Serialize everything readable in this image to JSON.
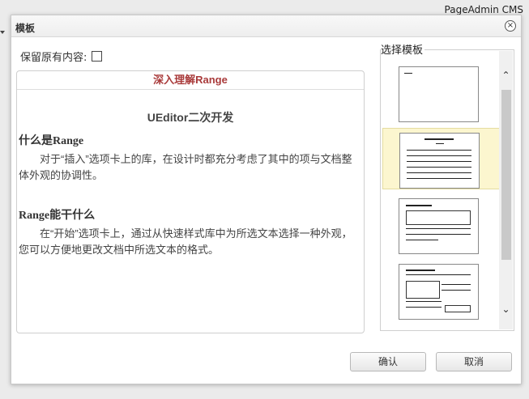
{
  "background": {
    "brand": "PageAdmin CMS"
  },
  "dialog": {
    "title": "模板",
    "close": "×",
    "keep_label": "保留原有内容:",
    "template_label": "选择模板",
    "ok": "确认",
    "cancel": "取消"
  },
  "preview": {
    "title": "深入理解Range",
    "subtitle": "UEditor二次开发",
    "h1": "什么是Range",
    "p1": "对于“插入”选项卡上的库，在设计时都充分考虑了其中的项与文档整体外观的协调性。",
    "h2": "Range能干什么",
    "p2": "在“开始”选项卡上，通过从快速样式库中为所选文本选择一种外观，您可以方便地更改文档中所选文本的格式。"
  },
  "templates": {
    "selected_index": 1,
    "count": 4
  },
  "scroll": {
    "up": "⌃",
    "down": "⌄"
  },
  "colors": {
    "title_red": "#a93a3a",
    "selected_bg": "#fcf6cf"
  }
}
